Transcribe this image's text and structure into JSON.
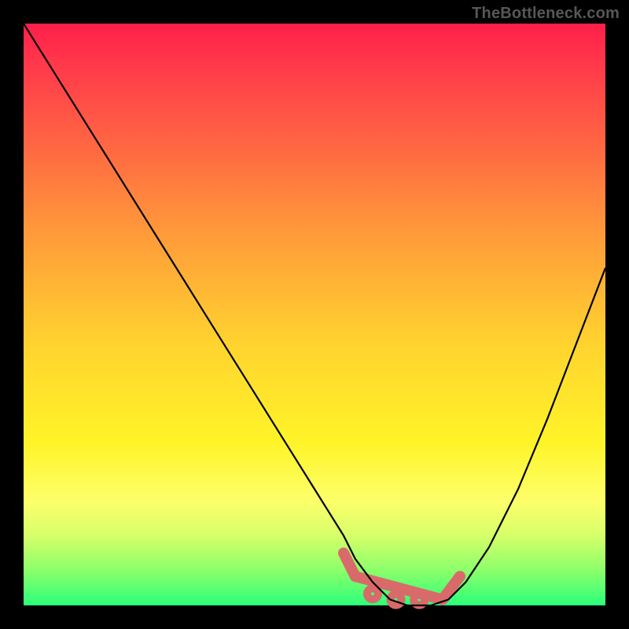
{
  "branding": {
    "watermark": "TheBottleneck.com"
  },
  "chart_data": {
    "type": "line",
    "title": "",
    "xlabel": "",
    "ylabel": "",
    "xlim": [
      0,
      100
    ],
    "ylim": [
      0,
      100
    ],
    "grid": false,
    "legend": false,
    "background_gradient": {
      "direction": "vertical",
      "stops": [
        {
          "pos": 0.0,
          "color": "#ff1f4a"
        },
        {
          "pos": 0.22,
          "color": "#ff6a42"
        },
        {
          "pos": 0.55,
          "color": "#ffd32f"
        },
        {
          "pos": 0.82,
          "color": "#fdff6a"
        },
        {
          "pos": 1.0,
          "color": "#2bff7a"
        }
      ]
    },
    "series": [
      {
        "name": "bottleneck-curve",
        "x": [
          0,
          5,
          10,
          15,
          20,
          25,
          30,
          35,
          40,
          45,
          50,
          55,
          57,
          60,
          63,
          66,
          68,
          70,
          73,
          76,
          80,
          85,
          90,
          95,
          100
        ],
        "y": [
          100,
          92,
          84,
          76,
          68,
          60,
          52,
          44,
          36,
          28,
          20,
          12,
          8,
          4,
          1,
          0,
          0,
          0,
          1,
          4,
          10,
          20,
          32,
          45,
          58
        ]
      }
    ],
    "markers": [
      {
        "name": "flat-minimum",
        "shape": "segment",
        "x0": 57,
        "y0": 5,
        "x1": 72,
        "y1": 1
      },
      {
        "name": "left-edge-marker",
        "shape": "segment",
        "x0": 55,
        "y0": 9,
        "x1": 57,
        "y1": 5
      },
      {
        "name": "right-edge-marker",
        "shape": "segment",
        "x0": 72,
        "y0": 1,
        "x1": 75,
        "y1": 5
      },
      {
        "name": "bottom-dot-1",
        "shape": "dot",
        "x": 60,
        "y": 2
      },
      {
        "name": "bottom-dot-2",
        "shape": "dot",
        "x": 64,
        "y": 1
      },
      {
        "name": "bottom-dot-3",
        "shape": "dot",
        "x": 68,
        "y": 1
      }
    ],
    "colors": {
      "curve": "#000000",
      "marker": "#d96a6a"
    }
  }
}
